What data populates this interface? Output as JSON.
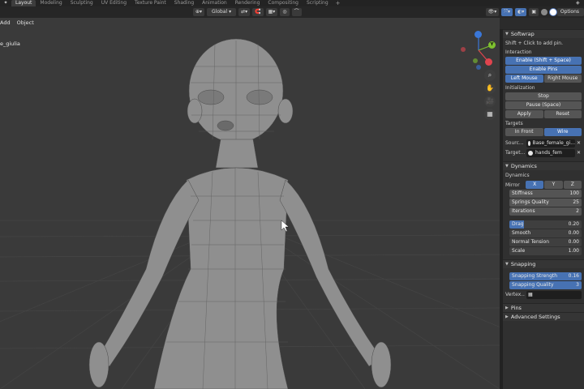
{
  "topbar": {
    "tabs": [
      "Layout",
      "Modeling",
      "Sculpting",
      "UV Editing",
      "Texture Paint",
      "Shading",
      "Animation",
      "Rendering",
      "Compositing",
      "Scripting"
    ],
    "active_tab": "Layout",
    "add_tab": "+"
  },
  "header": {
    "orientation": "Global",
    "options_label": "Options"
  },
  "viewport": {
    "menu": [
      "Add",
      "Object"
    ],
    "object_name": "e_giulia",
    "background_color": "#3a3a3a",
    "grid_color": "#444444"
  },
  "gizmo": {
    "y_label": "Y",
    "colors": {
      "x": "#e0444e",
      "y": "#7ec12f",
      "z": "#3a77d8"
    }
  },
  "panel": {
    "softwrap": {
      "title": "Softwrap",
      "hint": "Shift + Click to add pin.",
      "interaction_label": "Interaction",
      "enable_button": "Enable (Shift + Space)",
      "enable_pins": "Enable Pins",
      "left_mouse": "Left Mouse",
      "right_mouse": "Right Mouse",
      "initialization_label": "Initialization",
      "stop": "Stop",
      "pause": "Pause (Space)",
      "apply": "Apply",
      "reset": "Reset",
      "targets_label": "Targets",
      "in_front": "In Front",
      "wire": "Wire",
      "source_label": "Sourc...",
      "source_value": "Base_female_gi...",
      "target_label": "Target...",
      "target_value": "hands_fem"
    },
    "dynamics": {
      "title": "Dynamics",
      "sub_label": "Dynamics",
      "mirror_label": "Mirror",
      "mirror_axes": [
        "X",
        "Y",
        "Z"
      ],
      "stiffness_label": "Stiffness",
      "stiffness_value": "100",
      "springs_label": "Springs Quality",
      "springs_value": "25",
      "iterations_label": "Iterations",
      "iterations_value": "2",
      "drag_label": "Drag",
      "drag_value": "0.20",
      "drag_fraction": 0.2,
      "smooth_label": "Smooth",
      "smooth_value": "0.00",
      "normal_label": "Normal Tension",
      "normal_value": "0.00",
      "scale_label": "Scale",
      "scale_value": "1.00"
    },
    "snapping": {
      "title": "Snapping",
      "strength_label": "Snapping Strength",
      "strength_value": "0.16",
      "quality_label": "Snapping Quality",
      "quality_value": "3",
      "vertex_label": "Vertex..."
    },
    "pins_title": "Pins",
    "advanced_title": "Advanced Settings"
  },
  "accent_color": "#4772b3"
}
